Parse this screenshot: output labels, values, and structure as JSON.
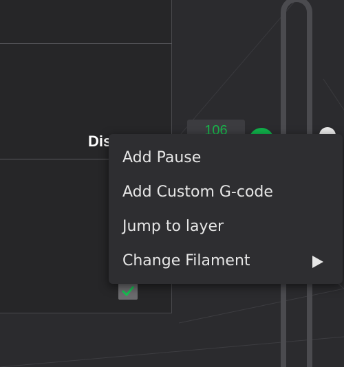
{
  "preview_panel": {
    "title_text": "Dis",
    "checkbox_checked": true
  },
  "layer_slider": {
    "current_layer": "106",
    "accent_color": "#10b04a"
  },
  "context_menu": {
    "items": [
      {
        "label": "Add Pause",
        "has_submenu": false
      },
      {
        "label": "Add Custom G-code",
        "has_submenu": false
      },
      {
        "label": "Jump to layer",
        "has_submenu": false
      },
      {
        "label": "Change Filament",
        "has_submenu": true
      }
    ]
  },
  "icons": {
    "checkbox": "check-icon",
    "submenu": "chevron-right-icon",
    "settings": "gear-icon"
  }
}
